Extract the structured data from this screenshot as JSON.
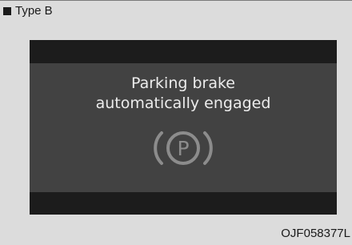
{
  "header": {
    "type_label": "Type B"
  },
  "display": {
    "message_line1": "Parking brake",
    "message_line2": "automatically engaged",
    "icon": "parking-brake-icon",
    "icon_letter": "P",
    "icon_color": "#8c8c8c"
  },
  "footer": {
    "figure_code": "OJF058377L"
  }
}
